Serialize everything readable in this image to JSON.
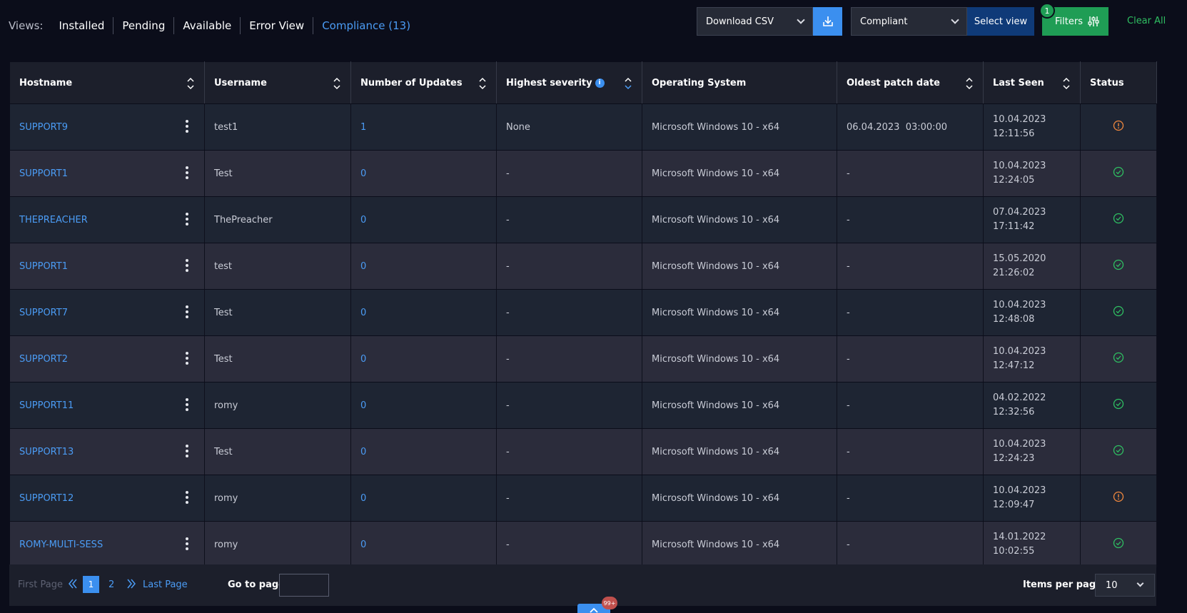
{
  "header": {
    "views_label": "Views:",
    "tabs": [
      {
        "label": "Installed",
        "active": false
      },
      {
        "label": "Pending",
        "active": false
      },
      {
        "label": "Available",
        "active": false
      },
      {
        "label": "Error View",
        "active": false
      },
      {
        "label": "Compliance (13)",
        "active": true
      }
    ],
    "download_csv": "Download CSV",
    "view_select": "Compliant",
    "select_view_label": "Select view",
    "filters_label": "Filters",
    "filters_count": "1",
    "clear_all": "Clear All"
  },
  "table": {
    "columns": [
      "Hostname",
      "Username",
      "Number of Updates",
      "Highest severity",
      "Operating System",
      "Oldest patch date",
      "Last Seen",
      "Status"
    ],
    "rows": [
      {
        "hostname": "SUPPORT9",
        "username": "test1",
        "updates": "1",
        "severity": "None",
        "os": "Microsoft Windows 10 - x64",
        "oldest": "06.04.2023  03:00:00",
        "last_date": "10.04.2023",
        "last_time": "12:11:56",
        "status": "warning"
      },
      {
        "hostname": "SUPPORT1",
        "username": "Test",
        "updates": "0",
        "severity": "-",
        "os": "Microsoft Windows 10 - x64",
        "oldest": "-",
        "last_date": "10.04.2023",
        "last_time": "12:24:05",
        "status": "ok"
      },
      {
        "hostname": "THEPREACHER",
        "username": "ThePreacher",
        "updates": "0",
        "severity": "-",
        "os": "Microsoft Windows 10 - x64",
        "oldest": "-",
        "last_date": "07.04.2023",
        "last_time": "17:11:42",
        "status": "ok"
      },
      {
        "hostname": "SUPPORT1",
        "username": "test",
        "updates": "0",
        "severity": "-",
        "os": "Microsoft Windows 10 - x64",
        "oldest": "-",
        "last_date": "15.05.2020",
        "last_time": "21:26:02",
        "status": "ok"
      },
      {
        "hostname": "SUPPORT7",
        "username": "Test",
        "updates": "0",
        "severity": "-",
        "os": "Microsoft Windows 10 - x64",
        "oldest": "-",
        "last_date": "10.04.2023",
        "last_time": "12:48:08",
        "status": "ok"
      },
      {
        "hostname": "SUPPORT2",
        "username": "Test",
        "updates": "0",
        "severity": "-",
        "os": "Microsoft Windows 10 - x64",
        "oldest": "-",
        "last_date": "10.04.2023",
        "last_time": "12:47:12",
        "status": "ok"
      },
      {
        "hostname": "SUPPORT11",
        "username": "romy",
        "updates": "0",
        "severity": "-",
        "os": "Microsoft Windows 10 - x64",
        "oldest": "-",
        "last_date": "04.02.2022",
        "last_time": "12:32:56",
        "status": "ok"
      },
      {
        "hostname": "SUPPORT13",
        "username": "Test",
        "updates": "0",
        "severity": "-",
        "os": "Microsoft Windows 10 - x64",
        "oldest": "-",
        "last_date": "10.04.2023",
        "last_time": "12:24:23",
        "status": "ok"
      },
      {
        "hostname": "SUPPORT12",
        "username": "romy",
        "updates": "0",
        "severity": "-",
        "os": "Microsoft Windows 10 - x64",
        "oldest": "-",
        "last_date": "10.04.2023",
        "last_time": "12:09:47",
        "status": "warning"
      },
      {
        "hostname": "ROMY-MULTI-SESS",
        "username": "romy",
        "updates": "0",
        "severity": "-",
        "os": "Microsoft Windows 10 - x64",
        "oldest": "-",
        "last_date": "14.01.2022",
        "last_time": "10:02:55",
        "status": "ok"
      }
    ]
  },
  "pagination": {
    "first_page": "First Page",
    "current": "1",
    "next_num": "2",
    "last_page": "Last Page",
    "goto_label": "Go to page:",
    "goto_value": "",
    "items_per_page_label": "Items per page:",
    "items_per_page": "10"
  },
  "notification_badge": "99+",
  "colors": {
    "accent": "#3b8fef",
    "ok": "#2fbf62",
    "warning": "#f0883e",
    "filters": "#1f9d55"
  }
}
